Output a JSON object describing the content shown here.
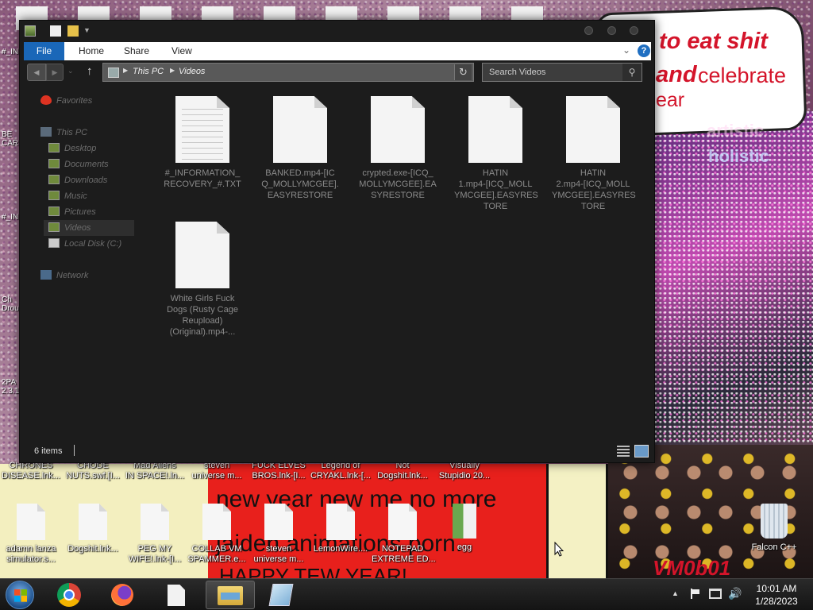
{
  "wallpaper": {
    "bubble_line1": "to eat shit",
    "bubble_line2a": "and",
    "bubble_line2b": "celebrate",
    "bubble_line3": "ear",
    "mid_label": "artistic",
    "mid_label2": "holistic",
    "red_line1": "new year new me no more",
    "red_line2": "jaiden animations porn.",
    "red_line3": "HAPPY  TEW YEAR!",
    "watermark": "VM0b01"
  },
  "desktop": {
    "edge_labels": [
      "#_IN",
      "BE\nCAR",
      "#_IN",
      "Ch\nDrou",
      "2PA\n2.3.1"
    ],
    "top_row": [
      "CHRONES\nDISEASE.lnk...",
      "CHODE\nNUTS.swf.[I...",
      "Mad Aliens\nIN SPACE!.ln...",
      "steven\nuniverse m...",
      "FUCK ELVES\nBROS.lnk-[I...",
      "Legend of\nCRYAKL.lnk-[...",
      "Not\nDogshit.lnk...",
      "Visually\nStupidio 20..."
    ],
    "bottom_row": [
      "adamn lanza\nsimulator.s...",
      "Dogshit.lnk...",
      "PEG MY\nWIFE!.lnk-[I...",
      "COLLAB VM\nSPAMMER.e...",
      "steven\nuniverse m...",
      "LemonWire....",
      "NOTEPAD\nEXTREME ED...",
      "egg"
    ],
    "recycle_bin": "Falcon C++"
  },
  "explorer": {
    "ribbon": {
      "file": "File",
      "home": "Home",
      "share": "Share",
      "view": "View",
      "help": "?"
    },
    "address": {
      "this_pc": "This PC",
      "videos": "Videos"
    },
    "search_placeholder": "Search Videos",
    "nav": {
      "favorites": "Favorites",
      "this_pc": "This PC",
      "desktop": "Desktop",
      "documents": "Documents",
      "downloads": "Downloads",
      "music": "Music",
      "pictures": "Pictures",
      "videos": "Videos",
      "local_disk": "Local Disk (C:)",
      "network": "Network"
    },
    "files": [
      "#_INFORMATION_\nRECOVERY_#.TXT",
      "BANKED.mp4-[IC\nQ_MOLLYMCGEE].\nEASYRESTORE",
      "crypted.exe-[ICQ_\nMOLLYMCGEE].EA\nSYRESTORE",
      "HATIN\n1.mp4-[ICQ_MOLL\nYMCGEE].EASYRES\nTORE",
      "HATIN\n2.mp4-[ICQ_MOLL\nYMCGEE].EASYRES\nTORE",
      "White Girls Fuck\nDogs (Rusty Cage\nReupload)\n(Original).mp4-..."
    ],
    "status_count": "6 items"
  },
  "taskbar": {
    "clock_time": "10:01 AM",
    "clock_date": "1/28/2023"
  }
}
